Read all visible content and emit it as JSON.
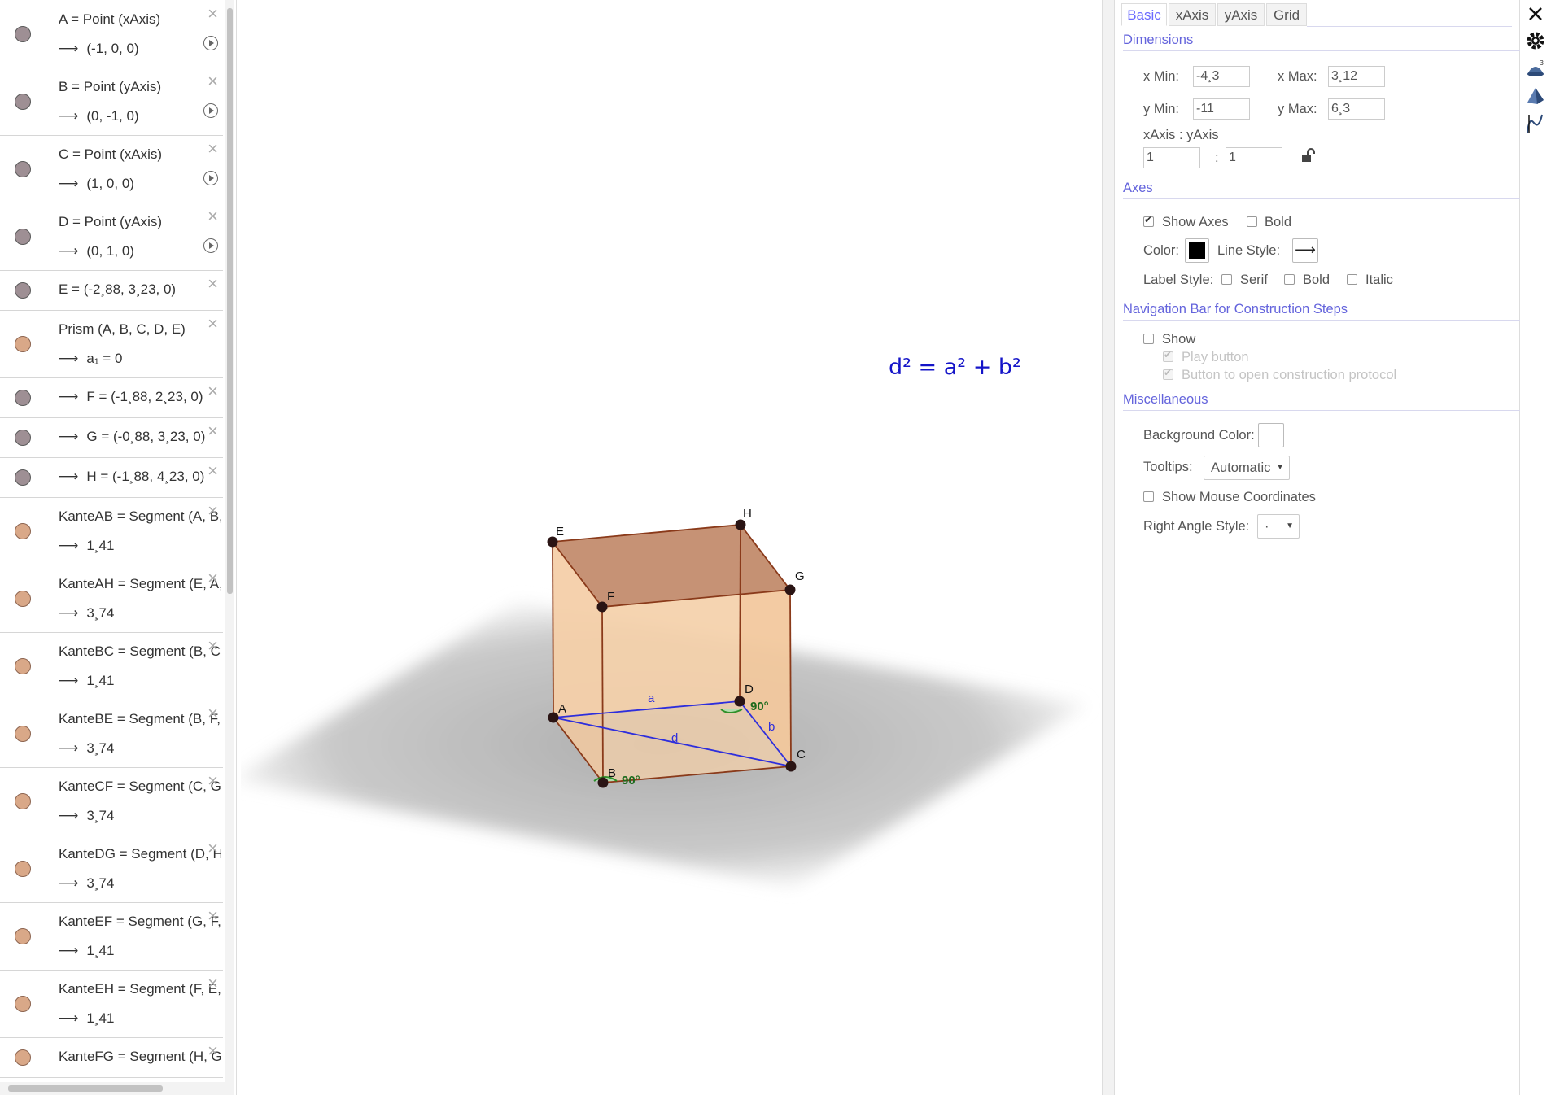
{
  "algebra": {
    "rows": [
      {
        "def": "A = Point (xAxis)",
        "val": "(-1, 0, 0)",
        "kind": "pt",
        "play": true
      },
      {
        "def": "B = Point (yAxis)",
        "val": "(0, -1, 0)",
        "kind": "pt",
        "play": true
      },
      {
        "def": "C = Point (xAxis)",
        "val": "(1, 0, 0)",
        "kind": "pt",
        "play": true
      },
      {
        "def": "D = Point (yAxis)",
        "val": "(0, 1, 0)",
        "kind": "pt",
        "play": true
      },
      {
        "def": "E = (-2¸88, 3¸23, 0)",
        "val": "",
        "kind": "pt",
        "play": false
      },
      {
        "def": "Prism (A, B, C, D, E)",
        "val": "a₁ = 0",
        "kind": "sh",
        "play": false
      },
      {
        "def": "",
        "val": "F = (-1¸88, 2¸23, 0)",
        "kind": "pt",
        "play": false
      },
      {
        "def": "",
        "val": "G = (-0¸88, 3¸23, 0)",
        "kind": "pt",
        "play": false
      },
      {
        "def": "",
        "val": "H = (-1¸88, 4¸23, 0)",
        "kind": "pt",
        "play": false
      },
      {
        "def": "KanteAB = Segment (A, B, a",
        "val": "1¸41",
        "kind": "sh",
        "play": false
      },
      {
        "def": "KanteAH = Segment (E, A, a",
        "val": "3¸74",
        "kind": "sh",
        "play": false
      },
      {
        "def": "KanteBC = Segment (B, C, a",
        "val": "1¸41",
        "kind": "sh",
        "play": false
      },
      {
        "def": "KanteBE = Segment (B, F, a",
        "val": "3¸74",
        "kind": "sh",
        "play": false
      },
      {
        "def": "KanteCF = Segment (C, G, a",
        "val": "3¸74",
        "kind": "sh",
        "play": false
      },
      {
        "def": "KanteDG = Segment (D, H, a",
        "val": "3¸74",
        "kind": "sh",
        "play": false
      },
      {
        "def": "KanteEF = Segment (G, F, a",
        "val": "1¸41",
        "kind": "sh",
        "play": false
      },
      {
        "def": "KanteEH = Segment (F, E, a",
        "val": "1¸41",
        "kind": "sh",
        "play": false
      },
      {
        "def": "KanteFG = Segment (H, G, a",
        "val": "",
        "kind": "sh",
        "play": false
      }
    ],
    "arrow": "⟶",
    "close": "×"
  },
  "graphics": {
    "formula": "d² = a² + b²",
    "points": {
      "A": "A",
      "B": "B",
      "C": "C",
      "D": "D",
      "E": "E",
      "F": "F",
      "G": "G",
      "H": "H"
    },
    "segments": {
      "a": "a",
      "b": "b",
      "d": "d"
    },
    "angle_label": "90°"
  },
  "settings": {
    "tabs": [
      "Basic",
      "xAxis",
      "yAxis",
      "Grid"
    ],
    "active_tab": "Basic",
    "dimensions": {
      "title": "Dimensions",
      "xmin_label": "x Min:",
      "xmin": "-4¸3",
      "xmax_label": "x Max:",
      "xmax": "3¸12",
      "ymin_label": "y Min:",
      "ymin": "-11",
      "ymax_label": "y Max:",
      "ymax": "6¸3",
      "ratio_label": "xAxis : yAxis",
      "ratio_x": "1",
      "ratio_sep": ":",
      "ratio_y": "1"
    },
    "axes": {
      "title": "Axes",
      "show_axes": "Show Axes",
      "bold": "Bold",
      "color_label": "Color:",
      "line_style_label": "Line Style:",
      "line_style_glyph": "⟶",
      "label_style": "Label Style:",
      "serif": "Serif",
      "bold2": "Bold",
      "italic": "Italic"
    },
    "navigation": {
      "title": "Navigation Bar for Construction Steps",
      "show": "Show",
      "play_button": "Play button",
      "protocol_button": "Button to open construction protocol"
    },
    "misc": {
      "title": "Miscellaneous",
      "bg_color": "Background Color:",
      "tooltips": "Tooltips:",
      "tooltips_value": "Automatic",
      "show_mouse": "Show Mouse Coordinates",
      "right_angle": "Right Angle Style:",
      "right_angle_value": "·"
    }
  },
  "colors": {
    "accent": "#6464dc",
    "formula": "#1515c8",
    "prism_fill": "#f2c9a0",
    "prism_edge": "#8a3a1a"
  }
}
